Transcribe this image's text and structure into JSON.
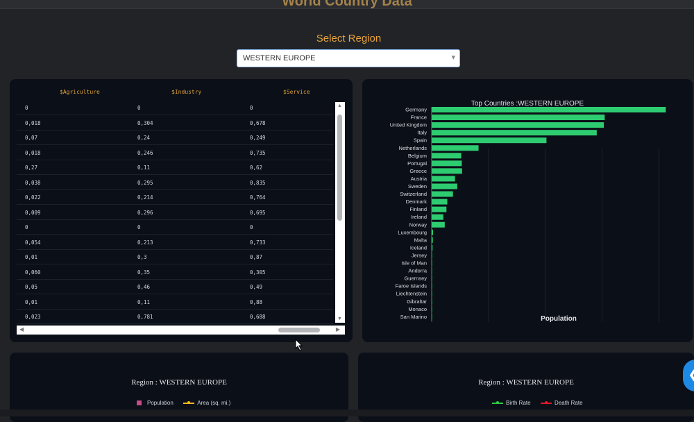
{
  "app": {
    "title": "World Country Data"
  },
  "region_select": {
    "label": "Select Region",
    "value": "WESTERN EUROPE"
  },
  "table": {
    "headers": [
      "$Agriculture",
      "$Industry",
      "$Service"
    ],
    "rows": [
      [
        "0",
        "0",
        "0"
      ],
      [
        "0,018",
        "0,304",
        "0,678"
      ],
      [
        "0,07",
        "0,24",
        "0,249"
      ],
      [
        "0,018",
        "0,246",
        "0,735"
      ],
      [
        "0,27",
        "0,11",
        "0,62"
      ],
      [
        "0,038",
        "0,295",
        "0,835"
      ],
      [
        "0,022",
        "0,214",
        "0,764"
      ],
      [
        "0,009",
        "0,296",
        "0,695"
      ],
      [
        "0",
        "0",
        "0"
      ],
      [
        "0,054",
        "0,213",
        "0,733"
      ],
      [
        "0,01",
        "0,3",
        "0,87"
      ],
      [
        "0,060",
        "0,35",
        "0,305"
      ],
      [
        "0,05",
        "0,46",
        "0,49"
      ],
      [
        "0,01",
        "0,11",
        "0,88"
      ],
      [
        "0,023",
        "0,781",
        "0,688"
      ]
    ]
  },
  "chart_data": {
    "type": "bar",
    "orientation": "horizontal",
    "title": "Top Countries :WESTERN EUROPE",
    "xlabel": "Population",
    "ylabel": "",
    "bar_color": "#2ecc71",
    "categories": [
      "Germany",
      "France",
      "United Kingdom",
      "Italy",
      "Spain",
      "Netherlands",
      "Belgium",
      "Portugal",
      "Greece",
      "Austria",
      "Sweden",
      "Switzerland",
      "Denmark",
      "Finland",
      "Ireland",
      "Norway",
      "Luxembourg",
      "Malta",
      "Iceland",
      "Jersey",
      "Isle of Man",
      "Andorra",
      "Guernsey",
      "Faroe Islands",
      "Liechtenstein",
      "Gibraltar",
      "Monaco",
      "San Marino"
    ],
    "values": [
      82.4,
      60.9,
      60.6,
      58.1,
      40.4,
      16.5,
      10.4,
      10.6,
      10.7,
      8.2,
      9.0,
      7.5,
      5.5,
      5.2,
      4.1,
      4.6,
      0.47,
      0.4,
      0.3,
      0.09,
      0.075,
      0.07,
      0.065,
      0.047,
      0.034,
      0.028,
      0.033,
      0.029
    ],
    "xlim": [
      0,
      85
    ]
  },
  "bottom_left": {
    "title": "Region : WESTERN EUROPE",
    "legend": [
      "Population",
      "Area (sq. mi.)"
    ],
    "colors": {
      "population": "#c84b8a",
      "area": "#f5b820"
    }
  },
  "bottom_right": {
    "title": "Region : WESTERN EUROPE",
    "legend": [
      "Birth Rate",
      "Death Rate"
    ],
    "colors": {
      "birth": "#2ecc40",
      "death": "#e0192b"
    }
  },
  "fab": {
    "icon": "chevron-left-icon",
    "color": "#1e88e5"
  }
}
